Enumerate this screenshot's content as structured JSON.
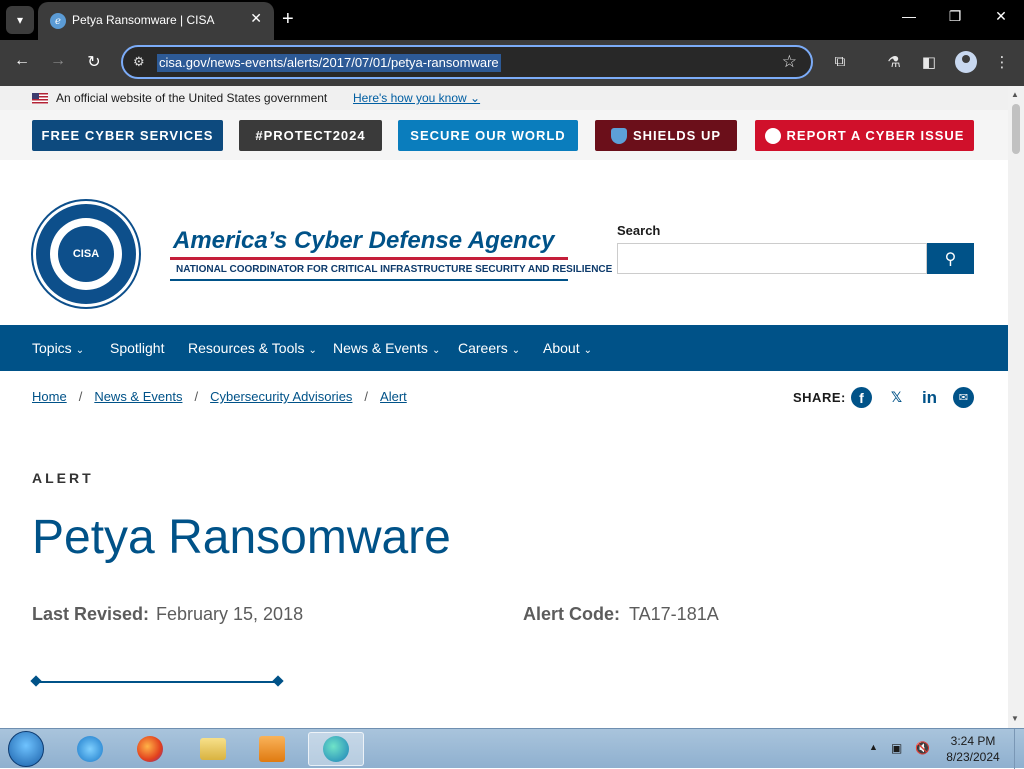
{
  "browser": {
    "tab_title": "Petya Ransomware | CISA",
    "url": "cisa.gov/news-events/alerts/2017/07/01/petya-ransomware",
    "icons": {
      "tab_dropdown": "▾",
      "favicon": "e",
      "close": "✕",
      "new_tab": "+",
      "minimize": "—",
      "restore": "❐",
      "window_close": "✕",
      "back": "←",
      "forward": "→",
      "reload": "↻",
      "site_info": "⚙",
      "star": "☆",
      "extensions": "⧉",
      "labs": "⚗",
      "side_panel": "◧",
      "menu": "⋮"
    }
  },
  "gov_banner": {
    "text": "An official website of the United States government",
    "link": "Here's how you know ⌄"
  },
  "utility_buttons": [
    {
      "label": "FREE CYBER SERVICES",
      "color": "#0d4a7e"
    },
    {
      "label": "#PROTECT2024",
      "color": "#3a3a3a"
    },
    {
      "label": "SECURE OUR WORLD",
      "color": "#0a7dbd"
    },
    {
      "label": "SHIELDS UP",
      "color": "#6b0f1a"
    },
    {
      "label": "REPORT A CYBER ISSUE",
      "color": "#d0102b"
    }
  ],
  "header": {
    "seal_text": "CISA",
    "agency_title": "America’s Cyber Defense Agency",
    "agency_subtitle": "NATIONAL COORDINATOR FOR CRITICAL INFRASTRUCTURE SECURITY AND RESILIENCE",
    "search_label": "Search",
    "search_placeholder": "",
    "search_icon": "⚲"
  },
  "nav": {
    "items": [
      {
        "label": "Topics",
        "has_menu": "⌄"
      },
      {
        "label": "Spotlight"
      },
      {
        "label": "Resources & Tools",
        "has_menu": "⌄"
      },
      {
        "label": "News & Events",
        "has_menu": "⌄"
      },
      {
        "label": "Careers",
        "has_menu": "⌄"
      },
      {
        "label": "About",
        "has_menu": "⌄"
      }
    ]
  },
  "breadcrumb": {
    "items": [
      "Home",
      "News & Events",
      "Cybersecurity Advisories",
      "Alert"
    ],
    "separator": "/"
  },
  "share": {
    "label": "SHARE:",
    "icons": {
      "facebook": "f",
      "x": "𝕏",
      "linkedin": "in",
      "email": "✉"
    }
  },
  "article": {
    "type": "ALERT",
    "title": "Petya Ransomware",
    "revised_label": "Last Revised:",
    "revised_value": "February 15, 2018",
    "code_label": "Alert Code:",
    "code_value": "TA17-181A"
  },
  "taskbar": {
    "time": "3:24 PM",
    "date": "8/23/2024",
    "tray_arrow": "▲",
    "tray_icons": {
      "network": "▣",
      "volume": "🔇"
    }
  }
}
